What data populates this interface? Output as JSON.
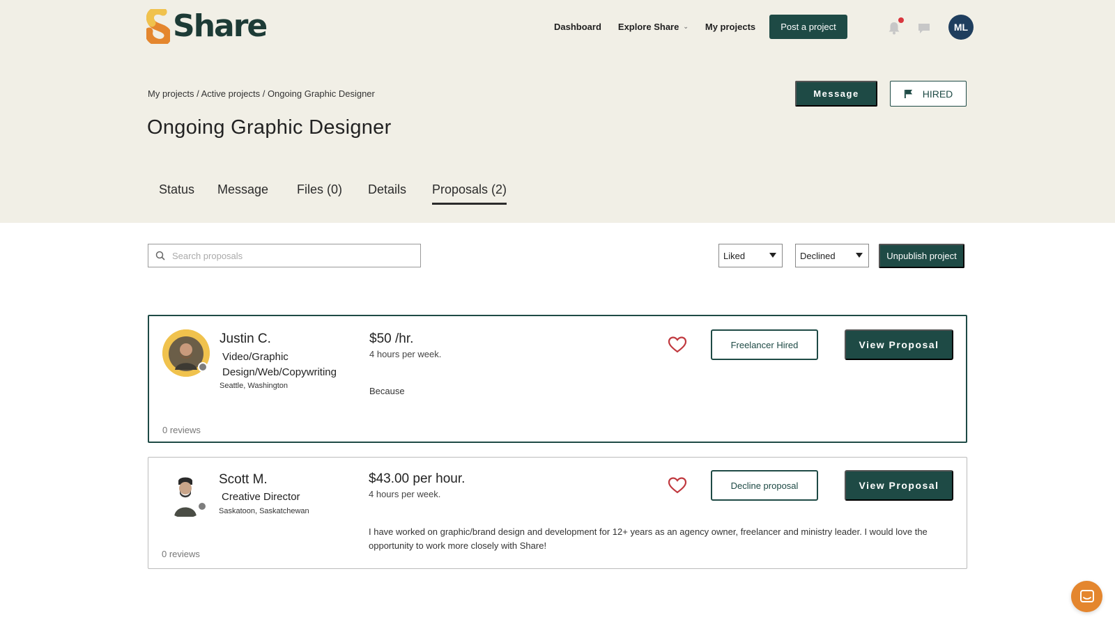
{
  "brand": {
    "name": "Share",
    "accent": "#1e4a45",
    "logo_orange": "#e4862e",
    "logo_yellow": "#f0c24d",
    "header_bg": "#f1efe6"
  },
  "nav": {
    "dashboard": "Dashboard",
    "explore": "Explore Share",
    "my_projects": "My projects",
    "post_project": "Post a project",
    "user_initials": "ML"
  },
  "breadcrumb": "My projects / Active projects / Ongoing Graphic Designer",
  "page_title": "Ongoing Graphic Designer",
  "actions": {
    "message": "Message",
    "hired": "HIRED"
  },
  "tabs": [
    {
      "label": "Status"
    },
    {
      "label": "Message"
    },
    {
      "label": "Files (0)"
    },
    {
      "label": "Details"
    },
    {
      "label": "Proposals (2)",
      "active": true
    }
  ],
  "toolbar": {
    "search_placeholder": "Search proposals",
    "filter_liked": "Liked",
    "filter_declined": "Declined",
    "unpublish": "Unpublish project"
  },
  "proposals": [
    {
      "name": "Justin C.",
      "role": "Video/Graphic Design/Web/Copywriting",
      "location": "Seattle, Washington",
      "price": "$50 /hr.",
      "hours": "4 hours per week.",
      "text": "Because",
      "reviews": "0 reviews",
      "status_action": "Freelancer Hired",
      "view": "View Proposal"
    },
    {
      "name": "Scott M.",
      "role": "Creative Director",
      "location": "Saskatoon, Saskatchewan",
      "price": "$43.00 per hour.",
      "hours": "4 hours per week.",
      "text": "I have worked on graphic/brand design and development for 12+ years as an agency owner, freelancer and ministry leader. I would love the opportunity to work more closely with Share!",
      "reviews": "0 reviews",
      "status_action": "Decline proposal",
      "view": "View Proposal"
    }
  ],
  "icons": [
    "search-icon",
    "bell-icon",
    "chat-icon",
    "flag-icon",
    "heart-icon",
    "chevron-down-icon",
    "caret-down-icon",
    "help-chat-icon"
  ]
}
